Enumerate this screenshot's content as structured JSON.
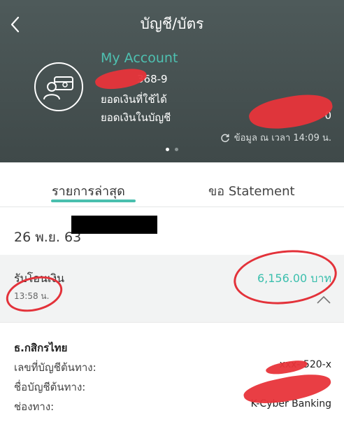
{
  "header": {
    "title": "บัญชี/บัตร",
    "account_name": "My Account",
    "account_number": "368-9",
    "available_label": "ยอดเงินที่ใช้ได้",
    "balance_label": "ยอดเงินในบัญชี",
    "balance_value_suffix": "0",
    "updated_text": "ข้อมูล ณ เวลา 14:09 น."
  },
  "tabs": [
    {
      "label": "รายการล่าสุด",
      "active": true
    },
    {
      "label": "ขอ Statement",
      "active": false
    }
  ],
  "transactions": {
    "date": "26 พ.ย. 63",
    "item": {
      "type": "รับโอนเงิน",
      "time": "13:58 น.",
      "amount": "6,156.00 บาท"
    }
  },
  "details": {
    "bank": "ธ.กสิกรไทย",
    "rows": [
      {
        "label": "เลขที่บัญชีต้นทาง:",
        "value": "xxx-   520-x"
      },
      {
        "label": "ชื่อบัญชีต้นทาง:",
        "value": ""
      },
      {
        "label": "ช่องทาง:",
        "value": "K-Cyber Banking"
      }
    ]
  },
  "colors": {
    "header_bg": "#465151",
    "accent": "#4ec1b1",
    "annotation_red": "#e3323a"
  },
  "icons": [
    "back-chevron-icon",
    "account-card-icon",
    "refresh-icon",
    "chevron-up-icon"
  ]
}
